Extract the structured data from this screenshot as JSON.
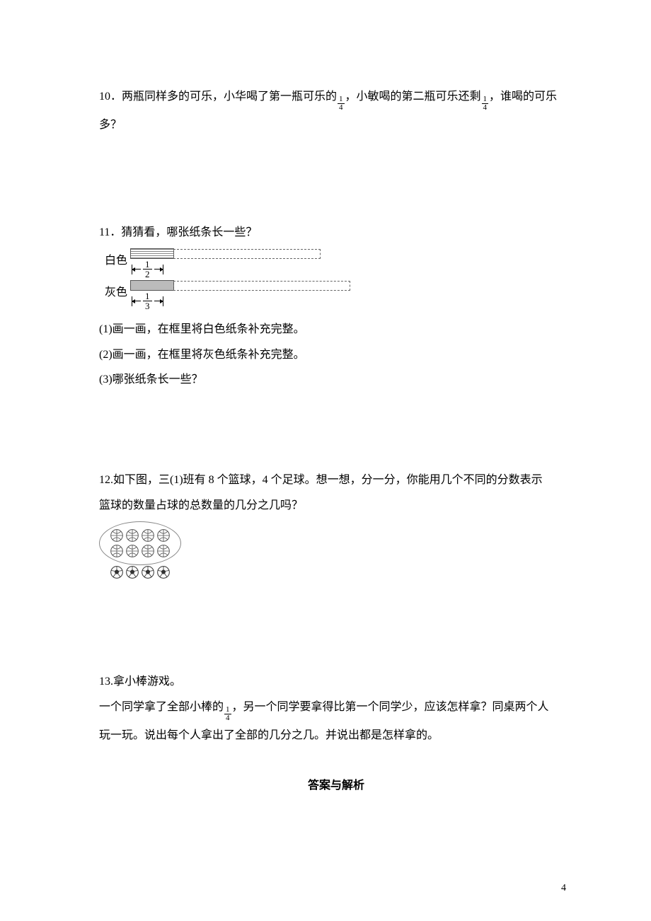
{
  "q10": {
    "text_a": "10．两瓶同样多的可乐，小华喝了第一瓶可乐的",
    "text_b": "，小敏喝的第二瓶可乐还剩",
    "text_c": "，谁喝的可乐",
    "text_d": "多？",
    "frac1": {
      "n": "1",
      "d": "4"
    },
    "frac2": {
      "n": "1",
      "d": "4"
    }
  },
  "q11": {
    "title": "11．猜猜看，哪张纸条长一些？",
    "label_white": "白色",
    "label_grey": "灰色",
    "frac_white": {
      "n": "1",
      "d": "2"
    },
    "frac_grey": {
      "n": "1",
      "d": "3"
    },
    "sub1": "(1)画一画，在框里将白色纸条补充完整。",
    "sub2": "(2)画一画，在框里将灰色纸条补充完整。",
    "sub3": "(3)哪张纸条长一些？"
  },
  "q12": {
    "text_a": "12.如下图，三(1)班有 8 个篮球，4 个足球。想一想，分一分，你能用几个不同的分数表示",
    "text_b": "篮球的数量占球的总数量的几分之几吗？"
  },
  "q13": {
    "title": "13.拿小棒游戏。",
    "text_a": "一个同学拿了全部小棒的",
    "frac": {
      "n": "1",
      "d": "4"
    },
    "text_b": "，另一个同学要拿得比第一个同学少，应该怎样拿？同桌两个人",
    "text_c": "玩一玩。说出每个人拿出了全部的几分之几。并说出都是怎样拿的。"
  },
  "answer_heading": "答案与解析",
  "page_number": "4"
}
